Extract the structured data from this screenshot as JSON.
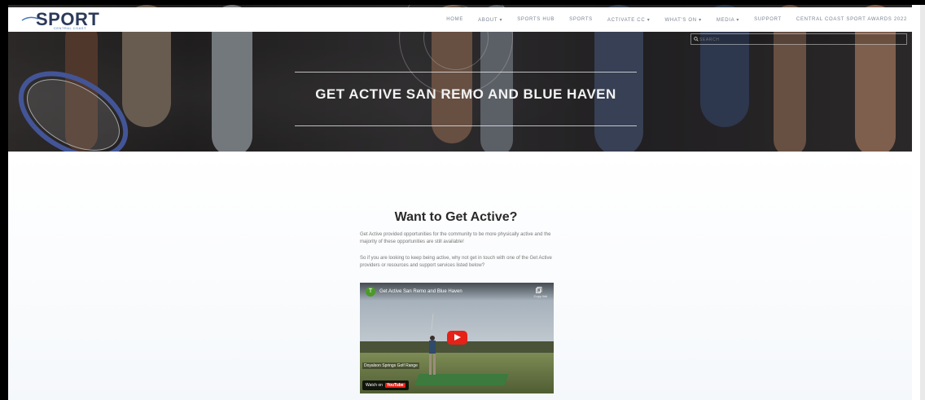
{
  "header": {
    "logo_text": "SPORT",
    "logo_sub": "CENTRAL COAST",
    "nav": [
      {
        "label": "HOME"
      },
      {
        "label": "ABOUT ▾"
      },
      {
        "label": "SPORTS HUB"
      },
      {
        "label": "SPORTS"
      },
      {
        "label": "ACTIVATE CC ▾"
      },
      {
        "label": "WHAT'S ON ▾"
      },
      {
        "label": "MEDIA ▾"
      },
      {
        "label": "SUPPORT"
      },
      {
        "label": "CENTRAL COAST SPORT AWARDS 2022"
      }
    ],
    "search_placeholder": "SEARCH"
  },
  "hero": {
    "title": "GET ACTIVE SAN REMO AND BLUE HAVEN"
  },
  "main": {
    "section_title": "Want to Get Active?",
    "paragraph_1": "Get Active provided opportunities for the community to be more physically active and the majority of these opportunities are still available!",
    "paragraph_2": "So if you are looking to keep being active, why not get in touch with one of the Get Active providers or resources and support services listed below?"
  },
  "video": {
    "channel_initial": "T",
    "title": "Get Active San Remo and Blue Haven",
    "copy_label": "Copy link",
    "caption": "Doyalson Springs Golf Range",
    "watch_on": "Watch on",
    "youtube": "YouTube"
  },
  "colors": {
    "brand_navy": "#2c3a5a",
    "brand_blue": "#4a78b8",
    "nav_text": "#7c8494",
    "youtube_red": "#e62117"
  }
}
